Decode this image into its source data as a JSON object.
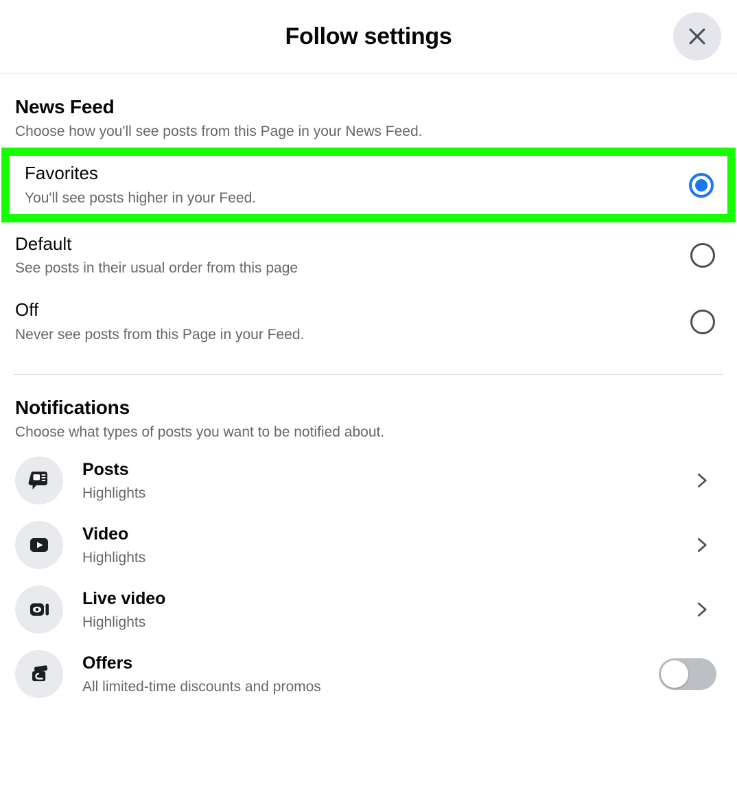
{
  "dialog": {
    "title": "Follow settings",
    "close_icon": "close-icon"
  },
  "news_feed": {
    "title": "News Feed",
    "subtitle": "Choose how you'll see posts from this Page in your News Feed.",
    "options": [
      {
        "label": "Favorites",
        "description": "You'll see posts higher in your Feed.",
        "selected": true,
        "highlighted": true
      },
      {
        "label": "Default",
        "description": "See posts in their usual order from this page",
        "selected": false,
        "highlighted": false
      },
      {
        "label": "Off",
        "description": "Never see posts from this Page in your Feed.",
        "selected": false,
        "highlighted": false
      }
    ]
  },
  "notifications": {
    "title": "Notifications",
    "subtitle": "Choose what types of posts you want to be notified about.",
    "rows": [
      {
        "label": "Posts",
        "value": "Highlights",
        "icon": "posts-bubble-icon",
        "control": "chevron"
      },
      {
        "label": "Video",
        "value": "Highlights",
        "icon": "video-play-icon",
        "control": "chevron"
      },
      {
        "label": "Live video",
        "value": "Highlights",
        "icon": "live-video-icon",
        "control": "chevron"
      },
      {
        "label": "Offers",
        "value": "All limited-time discounts and promos",
        "icon": "offers-tag-icon",
        "control": "toggle",
        "toggle_on": false
      }
    ]
  },
  "colors": {
    "accent_blue": "#1877f2",
    "highlight_green": "#15ff00",
    "text_primary": "#050505",
    "text_secondary": "#65676b",
    "icon_bubble": "#e8eaed",
    "toggle_off": "#bcc0c4"
  }
}
